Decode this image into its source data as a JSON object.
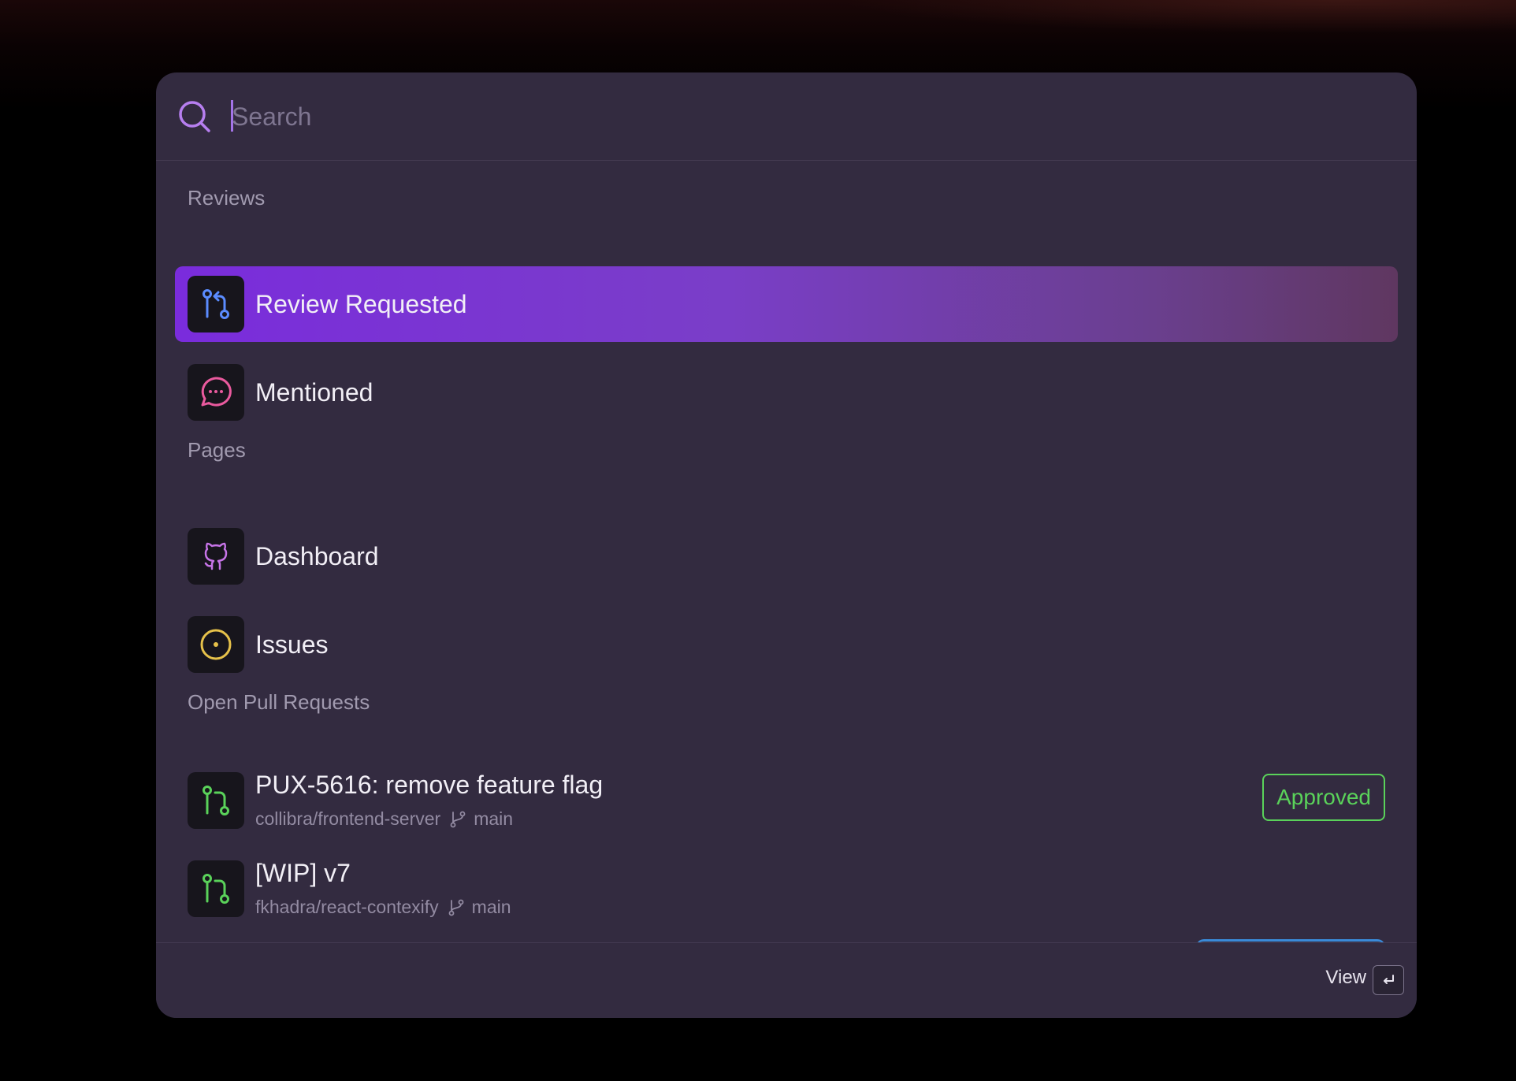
{
  "search": {
    "placeholder": "Search",
    "value": ""
  },
  "sections": {
    "reviews": "Reviews",
    "pages": "Pages",
    "open_prs": "Open Pull Requests"
  },
  "items": {
    "review_requested": {
      "label": "Review Requested",
      "icon": "git-pull-request-icon",
      "color": "#5b8cff"
    },
    "mentioned": {
      "label": "Mentioned",
      "icon": "message-dots-icon",
      "color": "#ea5a9e"
    },
    "dashboard": {
      "label": "Dashboard",
      "icon": "github-icon",
      "color": "#c774e8"
    },
    "issues": {
      "label": "Issues",
      "icon": "issue-circle-icon",
      "color": "#e6c14a"
    }
  },
  "pull_requests": [
    {
      "title": "PUX-5616: remove feature flag",
      "repo": "collibra/frontend-server",
      "branch": "main",
      "status": "Approved",
      "icon": "git-pull-request-icon",
      "color": "#5ad25a"
    },
    {
      "title": "[WIP] v7",
      "repo": "fkhadra/react-contexify",
      "branch": "main",
      "icon": "git-pull-request-icon",
      "color": "#5ad25a"
    }
  ],
  "footer": {
    "action_label": "View",
    "shortcut": "enter-key"
  },
  "colors": {
    "panel": "#332b40",
    "accent": "#7a2cdc",
    "approved": "#5ad25a"
  }
}
